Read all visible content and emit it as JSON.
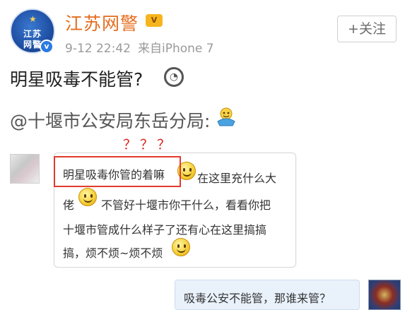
{
  "header": {
    "avatar_line1": "江苏",
    "avatar_line2": "网警",
    "username": "江苏网警",
    "timestamp": "9-12 22:42",
    "source": "来自iPhone 7",
    "follow_label": "+关注"
  },
  "post": {
    "text": "明星吸毒不能管?",
    "mention": "@十堰市公安局东岳分局:"
  },
  "annotation": {
    "question_marks": "？？？"
  },
  "chat": {
    "left_message_lines": [
      "明星吸毒你管的着嘛",
      "在这里充什么大",
      "佬",
      "不管好十堰市你干什么，看看你把",
      "十堰市管成什么样子了还有心在这里搞搞",
      "搞，烦不烦~烦不烦"
    ],
    "right_message": "吸毒公安不能管，那谁来管？"
  },
  "colors": {
    "username": "#e56c1d",
    "highlight_box": "#e23b2e",
    "right_bubble": "#e9f1fb"
  }
}
